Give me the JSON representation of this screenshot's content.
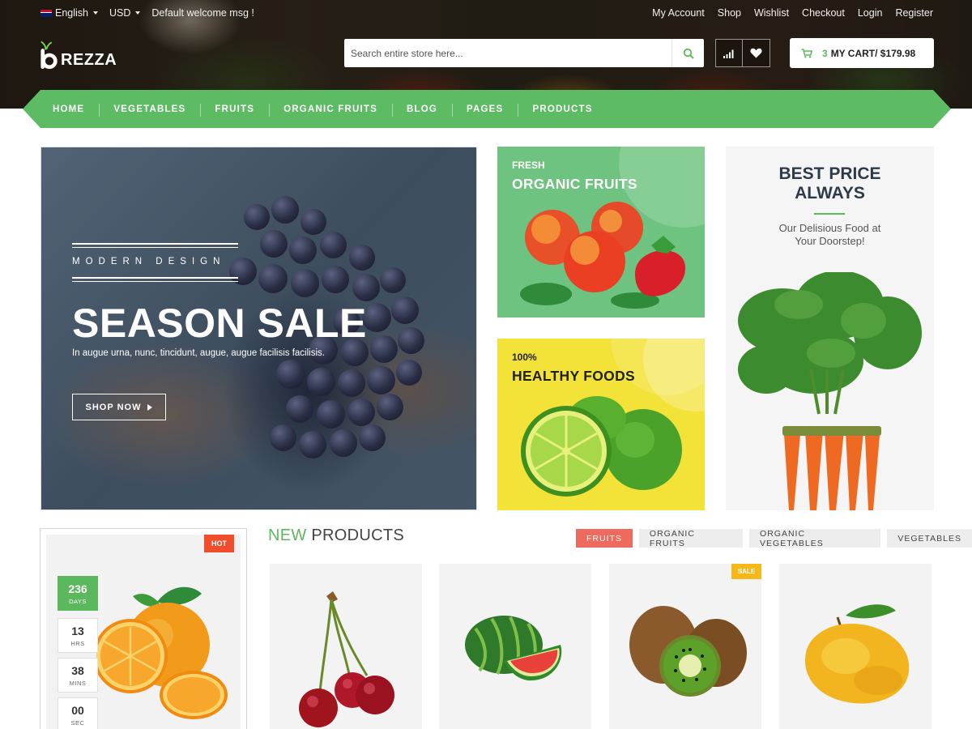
{
  "topbar": {
    "language": "English",
    "currency": "USD",
    "welcome": "Default welcome msg !",
    "links": [
      "My Account",
      "Shop",
      "Wishlist",
      "Checkout",
      "Login",
      "Register"
    ]
  },
  "logo": {
    "text": "REZZA"
  },
  "search": {
    "placeholder": "Search entire store here..."
  },
  "cart": {
    "count": "3",
    "label": "MY CART/ $179.98"
  },
  "nav": [
    "HOME",
    "VEGETABLES",
    "FRUITS",
    "ORGANIC FRUITS",
    "BLOG",
    "PAGES",
    "PRODUCTS"
  ],
  "hero": {
    "subtitle": "MODERN DESIGN",
    "title": "SEASON SALE",
    "description": "In augue urna, nunc, tincidunt, augue, augue facilisis facilisis.",
    "button": "SHOP NOW"
  },
  "promo_fruits": {
    "kicker": "FRESH",
    "title": "ORGANIC FRUITS"
  },
  "promo_healthy": {
    "kicker": "100%",
    "title": "HEALTHY FOODS"
  },
  "promo_side": {
    "title": "BEST PRICE ALWAYS",
    "description": "Our Delisious Food at Your Doorstep!"
  },
  "deal": {
    "badge": "HOT",
    "countdown": [
      {
        "value": "236",
        "label": "DAYS"
      },
      {
        "value": "13",
        "label": "HRS"
      },
      {
        "value": "38",
        "label": "MINS"
      },
      {
        "value": "00",
        "label": "SEC"
      }
    ]
  },
  "new_products": {
    "title_highlight": "NEW",
    "title_rest": "PRODUCTS",
    "tabs": [
      "FRUITS",
      "ORGANIC FRUITS",
      "ORGANIC VEGETABLES",
      "VEGETABLES"
    ],
    "sale_badge": "SALE"
  },
  "colors": {
    "accent": "#5cb85c",
    "hot": "#f04d2d",
    "tab_active": "#ee6a5e",
    "sale": "#f5b818",
    "healthy_bg": "#f3e238",
    "fruits_bg": "#6dc37f"
  },
  "icons": [
    "search-icon",
    "signal-icon",
    "heart-icon",
    "cart-icon",
    "chevron-right-icon"
  ]
}
